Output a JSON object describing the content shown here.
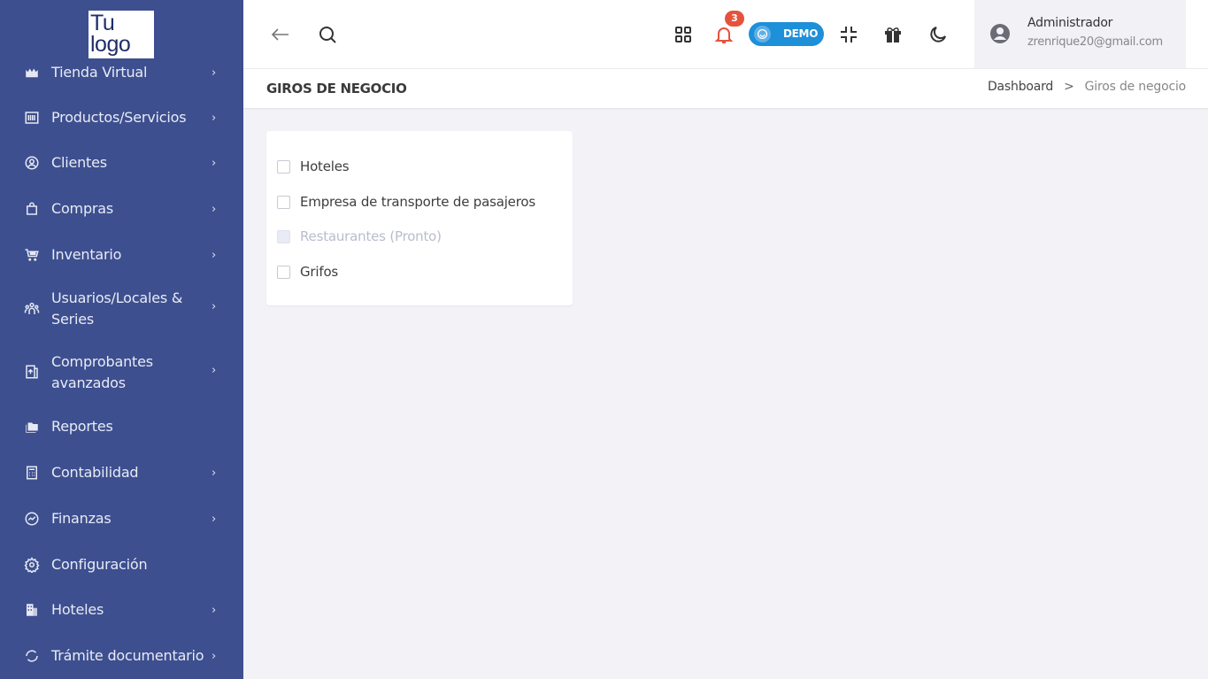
{
  "logo": {
    "line1": "Tu",
    "line2": "logo"
  },
  "sidebar": {
    "items": [
      {
        "label": "Tienda Virtual",
        "icon": "store-icon",
        "has_children": true
      },
      {
        "label": "Productos/Servicios",
        "icon": "barcode-icon",
        "has_children": true
      },
      {
        "label": "Clientes",
        "icon": "user-circle-icon",
        "has_children": true
      },
      {
        "label": "Compras",
        "icon": "shopping-bag-icon",
        "has_children": true
      },
      {
        "label": "Inventario",
        "icon": "cart-icon",
        "has_children": true
      },
      {
        "label": "Usuarios/Locales & Series",
        "icon": "users-icon",
        "has_children": true
      },
      {
        "label": "Comprobantes avanzados",
        "icon": "document-icon",
        "has_children": true
      },
      {
        "label": "Reportes",
        "icon": "folders-icon",
        "has_children": false
      },
      {
        "label": "Contabilidad",
        "icon": "calculator-icon",
        "has_children": true
      },
      {
        "label": "Finanzas",
        "icon": "chart-icon",
        "has_children": true
      },
      {
        "label": "Configuración",
        "icon": "gear-icon",
        "has_children": false
      },
      {
        "label": "Hoteles",
        "icon": "building-icon",
        "has_children": true
      },
      {
        "label": "Trámite documentario",
        "icon": "document-flow-icon",
        "has_children": true
      }
    ]
  },
  "topbar": {
    "notification_count": "3",
    "demo_label": "DEMO"
  },
  "user": {
    "name": "Administrador",
    "email": "zrenrique20@gmail.com"
  },
  "page": {
    "title": "GIROS DE NEGOCIO",
    "breadcrumb": {
      "home": "Dashboard",
      "separator": ">",
      "current": "Giros de negocio"
    }
  },
  "options": [
    {
      "label": "Hoteles",
      "checked": false,
      "disabled": false
    },
    {
      "label": "Empresa de transporte de pasajeros",
      "checked": false,
      "disabled": false
    },
    {
      "label": "Restaurantes (Pronto)",
      "checked": false,
      "disabled": true
    },
    {
      "label": "Grifos",
      "checked": false,
      "disabled": false
    }
  ],
  "colors": {
    "sidebar_bg": "#3d4f8f",
    "demo_bg": "#1e8fd9",
    "badge_bg": "#e5533d"
  }
}
